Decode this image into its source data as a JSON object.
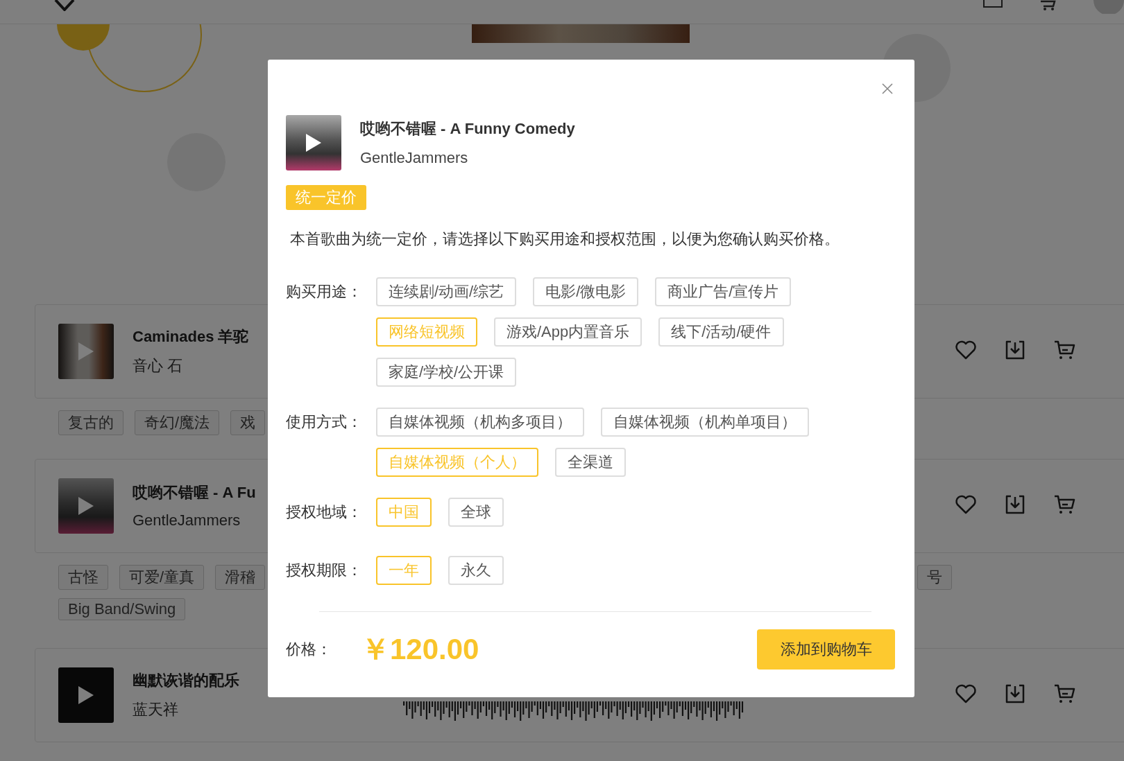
{
  "songs": [
    {
      "title": "Caminades 羊驼",
      "artist": "音心 石",
      "tags": [
        "复古的",
        "奇幻/魔法",
        "戏"
      ]
    },
    {
      "title": "哎哟不错喔 - A Fu",
      "artist": "GentleJammers",
      "tags": [
        "古怪",
        "可爱/童真",
        "滑稽",
        "Big Band/Swing"
      ],
      "right_tags": [
        "号"
      ]
    },
    {
      "title": "幽默诙谐的配乐",
      "artist": "蓝天祥",
      "waveform": true
    }
  ],
  "modal": {
    "title": "哎哟不错喔 - A Funny Comedy",
    "artist": "GentleJammers",
    "badge": "统一定价",
    "description": "本首歌曲为统一定价，请选择以下购买用途和授权范围，以便为您确认购买价格。",
    "groups": [
      {
        "label": "购买用途：",
        "options": [
          {
            "label": "连续剧/动画/综艺",
            "selected": false
          },
          {
            "label": "电影/微电影",
            "selected": false
          },
          {
            "label": "商业广告/宣传片",
            "selected": false
          },
          {
            "label": "网络短视频",
            "selected": true
          },
          {
            "label": "游戏/App内置音乐",
            "selected": false
          },
          {
            "label": "线下/活动/硬件",
            "selected": false
          },
          {
            "label": "家庭/学校/公开课",
            "selected": false
          }
        ]
      },
      {
        "label": "使用方式：",
        "options": [
          {
            "label": "自媒体视频（机构多项目）",
            "selected": false
          },
          {
            "label": "自媒体视频（机构单项目）",
            "selected": false
          },
          {
            "label": "自媒体视频（个人）",
            "selected": true
          },
          {
            "label": "全渠道",
            "selected": false
          }
        ]
      },
      {
        "label": "授权地域：",
        "options": [
          {
            "label": "中国",
            "selected": true
          },
          {
            "label": "全球",
            "selected": false
          }
        ]
      },
      {
        "label": "授权期限：",
        "options": [
          {
            "label": "一年",
            "selected": true
          },
          {
            "label": "永久",
            "selected": false
          }
        ]
      }
    ],
    "price_label": "价格：",
    "price": "￥120.00",
    "button": "添加到购物车"
  }
}
